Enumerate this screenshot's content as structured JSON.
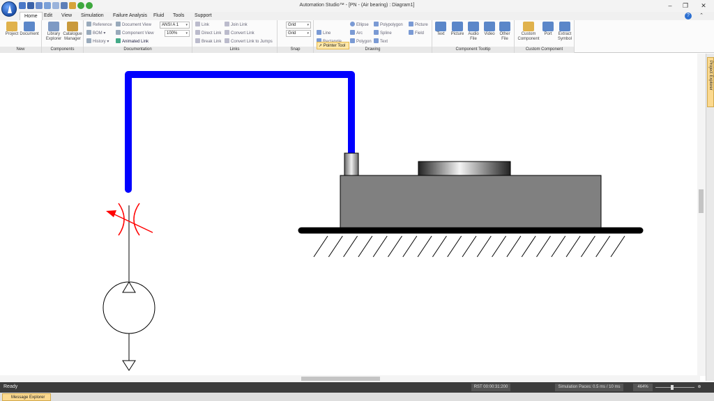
{
  "window": {
    "title": "Automation Studio™  - [PN -        (Air bearing) : Diagram1]",
    "minimize": "–",
    "restore": "❐",
    "close": "✕"
  },
  "tabs": [
    "Home",
    "Edit",
    "View",
    "Simulation",
    "Failure Analysis",
    "Fluid",
    "Tools",
    "Support"
  ],
  "help": "?",
  "ribbon": {
    "groups": {
      "new": "New",
      "components": "Components",
      "documentation": "Documentation",
      "links": "Links",
      "snap": "Snap",
      "drawing": "Drawing",
      "tooltip": "Component Tooltip",
      "custom": "Custom Component"
    },
    "new": {
      "project": "Project",
      "document": "Document"
    },
    "components": {
      "library": "Library Explorer",
      "catalogue": "Catalogue Manager"
    },
    "documentation": {
      "reference": "Reference",
      "bom": "BOM",
      "history": "History",
      "document_view": "Document View",
      "component_view": "Component View",
      "animated_link": "Animated Link",
      "standard": "ANSI A",
      "standard_num": "1",
      "zoom": "100%"
    },
    "links": {
      "link": "Link",
      "direct_link": "Direct Link",
      "break_link": "Break Link",
      "join_link": "Join Link",
      "convert_link": "Convert Link",
      "convert_jumps": "Convert Link to Jumps"
    },
    "snap": {
      "grid1": "Grid",
      "grid2": "Grid"
    },
    "drawing": {
      "pointer": "Pointer Tool",
      "line": "Line",
      "rectangle": "Rectangle",
      "ellipse": "Ellipse",
      "arc": "Arc",
      "polygon": "Polygon",
      "polypolygon": "Polypolygon",
      "spline": "Spline",
      "text": "Text",
      "picture": "Picture",
      "field": "Field"
    },
    "tooltip": {
      "text": "Text",
      "picture": "Picture",
      "audio": "Audio File",
      "video": "Video",
      "other": "Other File"
    },
    "custom": {
      "custom_component": "Custom Component",
      "port": "Port",
      "extract": "Extract Symbol"
    }
  },
  "side_panel": {
    "label": "Project Explorer"
  },
  "status": {
    "ready": "Ready",
    "rst": "RST 00:00:31:200",
    "paces": "Simulation Paces: 0.5 ms / 10 ms",
    "zoom": "464%"
  },
  "bottom": {
    "message_explorer": "Message Explorer"
  },
  "colors": {
    "line_blue": "#0000ff",
    "restrictor_red": "#ff0000",
    "block_gray": "#808080",
    "ground_black": "#000000"
  }
}
